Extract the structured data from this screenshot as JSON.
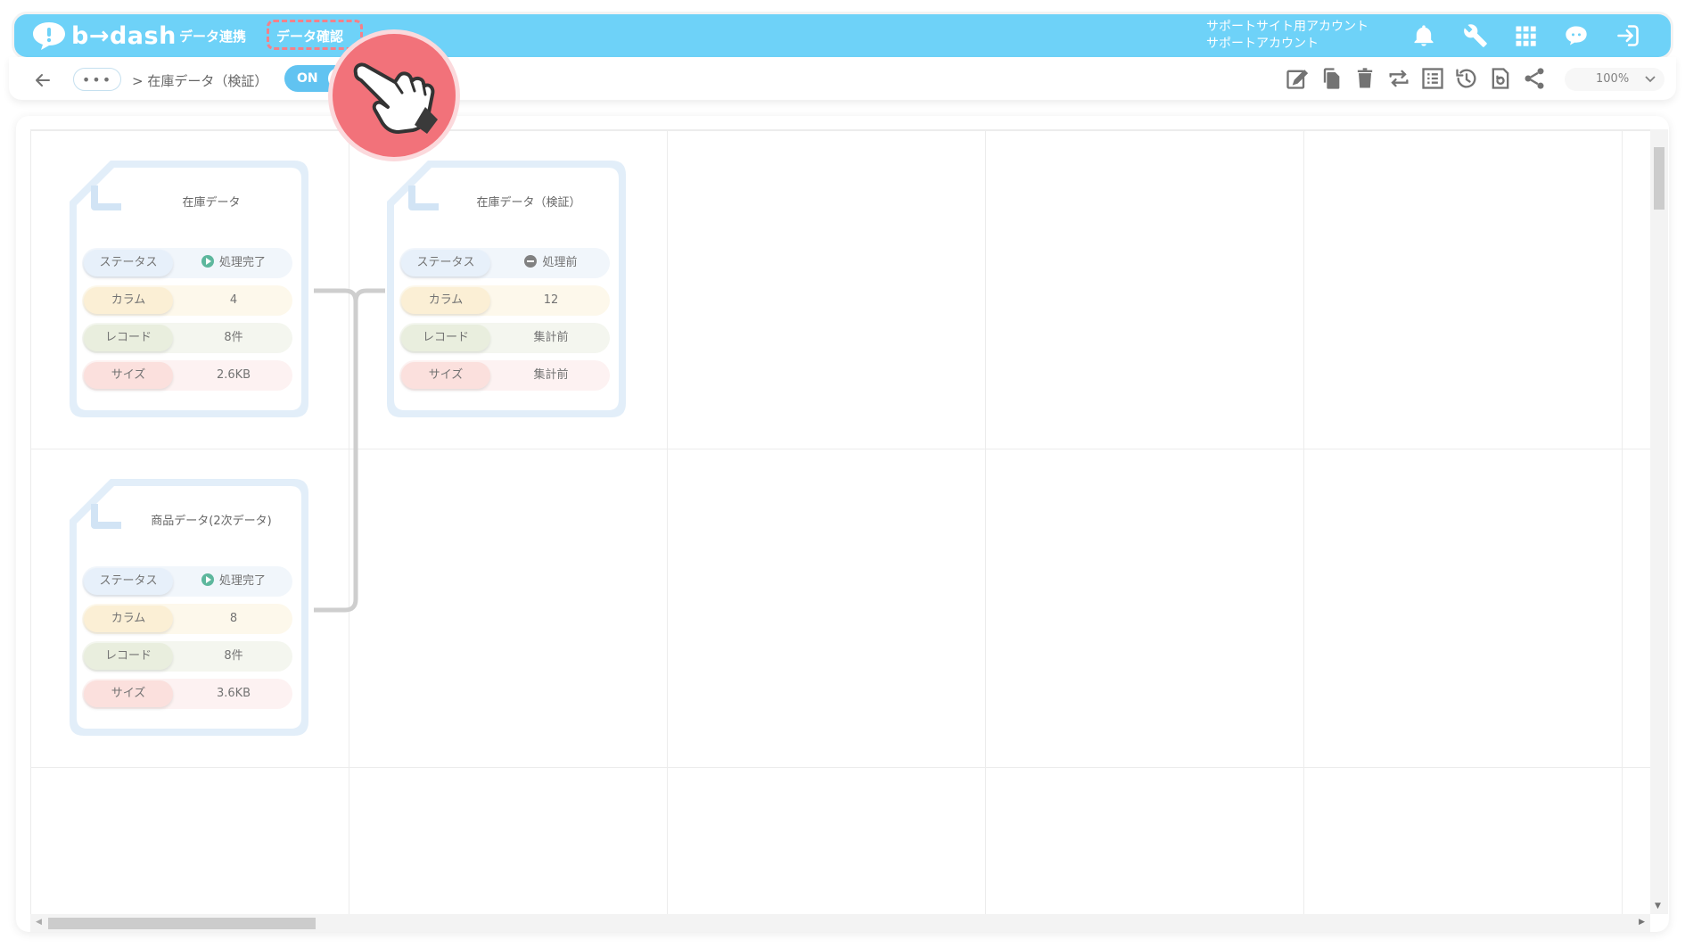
{
  "header": {
    "logo_text": "b→dash",
    "nav_data_sync": "データ連携",
    "nav_data_check": "データ確認",
    "account_line1": "サポートサイト用アカウント",
    "account_line2": "サポートアカウント",
    "brand_color": "#4fc8f7",
    "icons": [
      "bell-icon",
      "wrench-icon",
      "apps-grid-icon",
      "chat-bot-icon",
      "logout-icon"
    ]
  },
  "toolbar": {
    "more_label": "•••",
    "breadcrumb": "> 在庫データ（検証）",
    "toggle_label": "ON",
    "zoom": "100%",
    "icons": [
      "edit-icon",
      "copy-icon",
      "trash-icon",
      "sync-icon",
      "list-icon",
      "history-icon",
      "refresh-file-icon",
      "share-icon"
    ]
  },
  "cards": [
    {
      "title": "在庫データ",
      "status_label": "ステータス",
      "status_value": "処理完了",
      "status_kind": "done",
      "column_label": "カラム",
      "column_value": "4",
      "record_label": "レコード",
      "record_value": "8件",
      "size_label": "サイズ",
      "size_value": "2.6KB"
    },
    {
      "title": "在庫データ（検証）",
      "status_label": "ステータス",
      "status_value": "処理前",
      "status_kind": "pending",
      "column_label": "カラム",
      "column_value": "12",
      "record_label": "レコード",
      "record_value": "集計前",
      "size_label": "サイズ",
      "size_value": "集計前"
    },
    {
      "title": "商品データ(2次データ)",
      "status_label": "ステータス",
      "status_value": "処理完了",
      "status_kind": "done",
      "column_label": "カラム",
      "column_value": "8",
      "record_label": "レコード",
      "record_value": "8件",
      "size_label": "サイズ",
      "size_value": "3.6KB"
    }
  ],
  "colors": {
    "status_bg": "#eef4fb",
    "column_bg": "#fdf7e7",
    "record_bg": "#f2f5ec",
    "size_bg": "#fdf0ef",
    "highlight": "#f2656f"
  }
}
